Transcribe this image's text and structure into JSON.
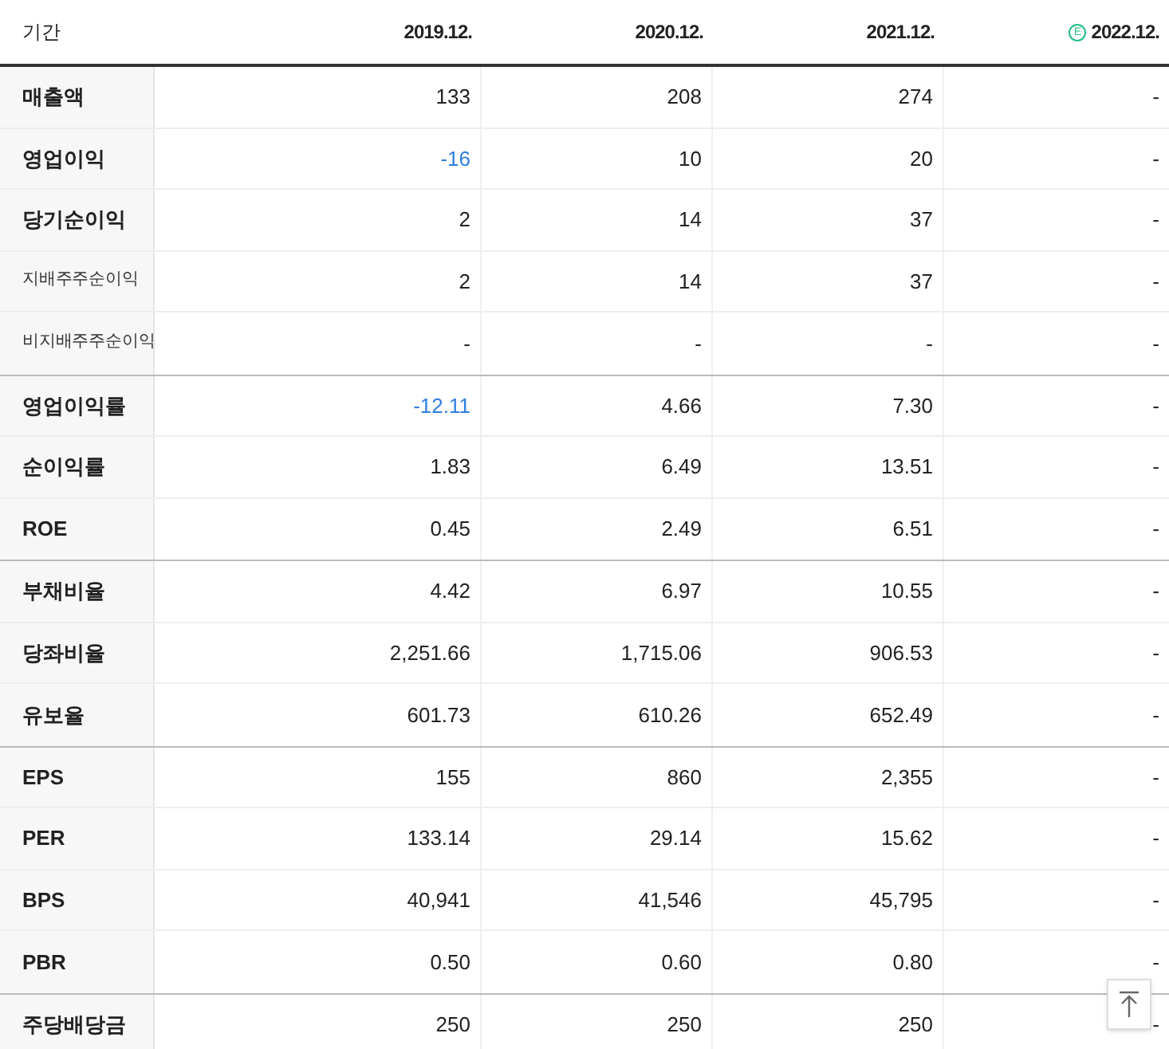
{
  "header": {
    "label": "기간",
    "estimate_mark": "E",
    "columns": [
      {
        "text": "2019.12.",
        "estimate": false
      },
      {
        "text": "2020.12.",
        "estimate": false
      },
      {
        "text": "2021.12.",
        "estimate": false
      },
      {
        "text": "2022.12.",
        "estimate": true
      }
    ]
  },
  "groups": [
    {
      "rows": [
        {
          "label": "매출액",
          "kind": "main",
          "values": [
            {
              "text": "133",
              "negative": false
            },
            {
              "text": "208",
              "negative": false
            },
            {
              "text": "274",
              "negative": false
            },
            {
              "text": "-",
              "negative": false
            }
          ]
        },
        {
          "label": "영업이익",
          "kind": "main",
          "values": [
            {
              "text": "-16",
              "negative": true
            },
            {
              "text": "10",
              "negative": false
            },
            {
              "text": "20",
              "negative": false
            },
            {
              "text": "-",
              "negative": false
            }
          ]
        },
        {
          "label": "당기순이익",
          "kind": "main",
          "values": [
            {
              "text": "2",
              "negative": false
            },
            {
              "text": "14",
              "negative": false
            },
            {
              "text": "37",
              "negative": false
            },
            {
              "text": "-",
              "negative": false
            }
          ]
        },
        {
          "label": "지배주주순이익",
          "kind": "sub",
          "values": [
            {
              "text": "2",
              "negative": false
            },
            {
              "text": "14",
              "negative": false
            },
            {
              "text": "37",
              "negative": false
            },
            {
              "text": "-",
              "negative": false
            }
          ]
        },
        {
          "label": "비지배주주순이익",
          "kind": "sub",
          "values": [
            {
              "text": "-",
              "negative": false
            },
            {
              "text": "-",
              "negative": false
            },
            {
              "text": "-",
              "negative": false
            },
            {
              "text": "-",
              "negative": false
            }
          ]
        }
      ]
    },
    {
      "rows": [
        {
          "label": "영업이익률",
          "kind": "main",
          "values": [
            {
              "text": "-12.11",
              "negative": true
            },
            {
              "text": "4.66",
              "negative": false
            },
            {
              "text": "7.30",
              "negative": false
            },
            {
              "text": "-",
              "negative": false
            }
          ]
        },
        {
          "label": "순이익률",
          "kind": "main",
          "values": [
            {
              "text": "1.83",
              "negative": false
            },
            {
              "text": "6.49",
              "negative": false
            },
            {
              "text": "13.51",
              "negative": false
            },
            {
              "text": "-",
              "negative": false
            }
          ]
        },
        {
          "label": "ROE",
          "kind": "main",
          "values": [
            {
              "text": "0.45",
              "negative": false
            },
            {
              "text": "2.49",
              "negative": false
            },
            {
              "text": "6.51",
              "negative": false
            },
            {
              "text": "-",
              "negative": false
            }
          ]
        }
      ]
    },
    {
      "rows": [
        {
          "label": "부채비율",
          "kind": "main",
          "values": [
            {
              "text": "4.42",
              "negative": false
            },
            {
              "text": "6.97",
              "negative": false
            },
            {
              "text": "10.55",
              "negative": false
            },
            {
              "text": "-",
              "negative": false
            }
          ]
        },
        {
          "label": "당좌비율",
          "kind": "main",
          "values": [
            {
              "text": "2,251.66",
              "negative": false
            },
            {
              "text": "1,715.06",
              "negative": false
            },
            {
              "text": "906.53",
              "negative": false
            },
            {
              "text": "-",
              "negative": false
            }
          ]
        },
        {
          "label": "유보율",
          "kind": "main",
          "values": [
            {
              "text": "601.73",
              "negative": false
            },
            {
              "text": "610.26",
              "negative": false
            },
            {
              "text": "652.49",
              "negative": false
            },
            {
              "text": "-",
              "negative": false
            }
          ]
        }
      ]
    },
    {
      "rows": [
        {
          "label": "EPS",
          "kind": "main",
          "values": [
            {
              "text": "155",
              "negative": false
            },
            {
              "text": "860",
              "negative": false
            },
            {
              "text": "2,355",
              "negative": false
            },
            {
              "text": "-",
              "negative": false
            }
          ]
        },
        {
          "label": "PER",
          "kind": "main",
          "values": [
            {
              "text": "133.14",
              "negative": false
            },
            {
              "text": "29.14",
              "negative": false
            },
            {
              "text": "15.62",
              "negative": false
            },
            {
              "text": "-",
              "negative": false
            }
          ]
        },
        {
          "label": "BPS",
          "kind": "main",
          "values": [
            {
              "text": "40,941",
              "negative": false
            },
            {
              "text": "41,546",
              "negative": false
            },
            {
              "text": "45,795",
              "negative": false
            },
            {
              "text": "-",
              "negative": false
            }
          ]
        },
        {
          "label": "PBR",
          "kind": "main",
          "values": [
            {
              "text": "0.50",
              "negative": false
            },
            {
              "text": "0.60",
              "negative": false
            },
            {
              "text": "0.80",
              "negative": false
            },
            {
              "text": "-",
              "negative": false
            }
          ]
        }
      ]
    },
    {
      "rows": [
        {
          "label": "주당배당금",
          "kind": "main",
          "values": [
            {
              "text": "250",
              "negative": false
            },
            {
              "text": "250",
              "negative": false
            },
            {
              "text": "250",
              "negative": false
            },
            {
              "text": "-",
              "negative": false
            }
          ]
        }
      ]
    }
  ]
}
